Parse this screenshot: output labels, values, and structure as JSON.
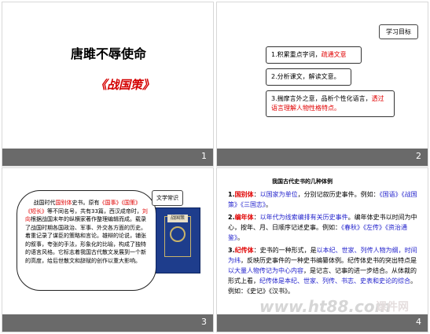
{
  "slide1": {
    "title": "唐雎不辱使命",
    "subtitle": "《战国策》",
    "number": "1"
  },
  "slide2": {
    "badge": "学习目标",
    "goal1_a": "1.积累重点字词，",
    "goal1_b": "疏通文意",
    "goal2": "2.分析课文，解读文意。",
    "goal3_a": "3.揣摩言外之意，品析个性化语言，",
    "goal3_b": "透过语言理解人物性格特点。",
    "number": "2"
  },
  "slide3": {
    "badge": "文学常识",
    "text_1": "战国时代",
    "text_2": "国别体",
    "text_3": "史书。原有",
    "text_4": "《国事》《国策》《短长》",
    "text_5": "等不同名号，共有33篇，西汉成帝时，",
    "text_6": "刘向",
    "text_7": "根据战国末年的纵横家著作整理编辑而成。载录了战国时期各国政治、军事、外交各方面的历史。着重记录了谋臣的策略和言论。雄辩的论说，铺张的叙事，夸张的手法，形象化的比喻，构成了独特的语言风格。它标志着我国古代散文发展到一个新的高度，给后世散文和辞赋的创作以重大影响。",
    "book_label": "战国策",
    "number": "3"
  },
  "slide4": {
    "heading": "我国古代史书的几种体例",
    "p1_a": "1.",
    "p1_b": "国别体",
    "p1_c": "：",
    "p1_d": "以国家为单位",
    "p1_e": "，分别记叙历史事件。例如：",
    "p1_f": "《国语》《战国策》《三国志》",
    "p1_g": "。",
    "p2_a": "2.",
    "p2_b": "编年体",
    "p2_c": "：",
    "p2_d": "以年代为线索编排有关历史事件",
    "p2_e": "。编年体史书以时间为中心，按年、月、日顺序记述史事。例如：",
    "p2_f": "《春秋》《左传》《资治通鉴》",
    "p2_g": "。",
    "p3_a": "3.",
    "p3_b": "纪传体",
    "p3_c": "：史书的一种形式，是",
    "p3_d": "以本纪、世家、列传人物为纲，时间为纬",
    "p3_e": "，反映历史事件的一种史书编纂体例。纪传体史书的突出特点是",
    "p3_f": "以大量人物传记为中心内容",
    "p3_g": "，是记言、记事的进一步结合。从体裁的形式上看，",
    "p3_h": "纪传体是本纪、世家、列传、书志、史表和史论的综合",
    "p3_i": "。例如：《史记》《汉书》。",
    "number": "4"
  },
  "watermark": "www.ht88.com",
  "watermark_cn": "课件网"
}
